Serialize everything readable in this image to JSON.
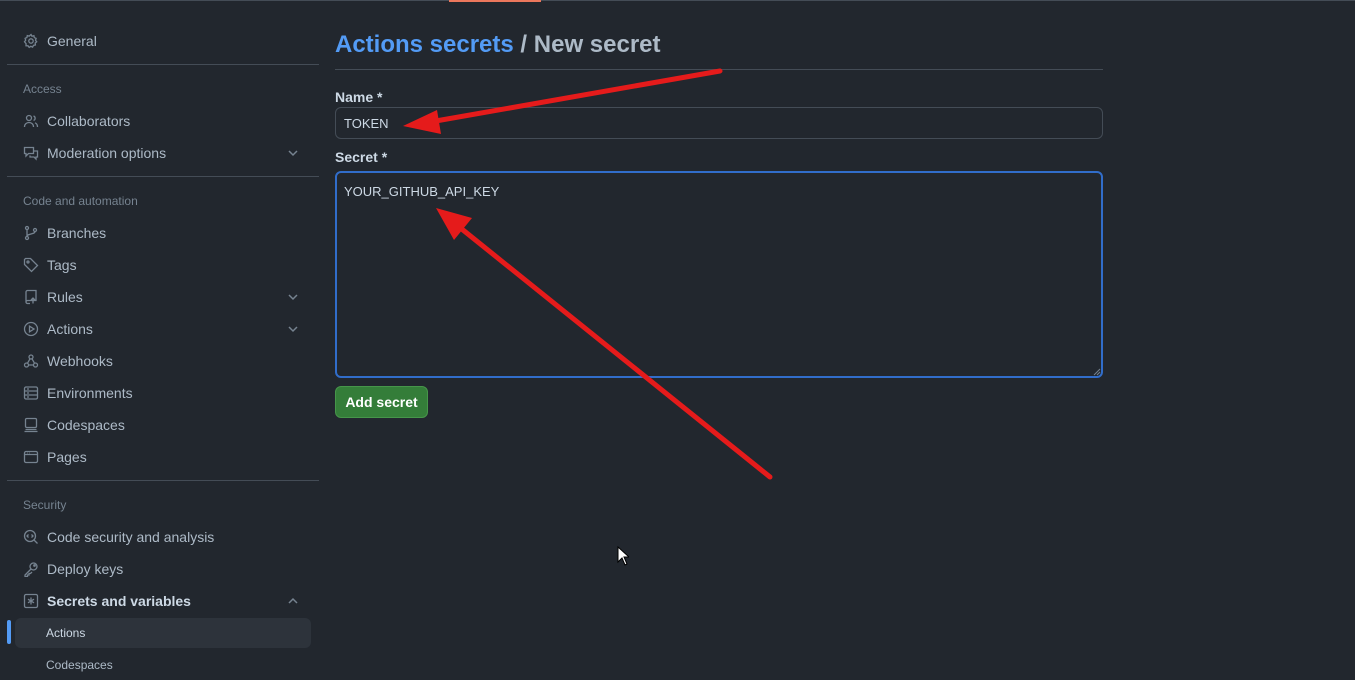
{
  "page": {
    "title_link": "Actions secrets",
    "title_separator": "/",
    "title_current": "New secret"
  },
  "sidebar": {
    "general": {
      "label": "General",
      "icon": "gear-icon"
    },
    "access": {
      "heading": "Access",
      "items": [
        {
          "label": "Collaborators",
          "icon": "people-icon"
        },
        {
          "label": "Moderation options",
          "icon": "comment-discussion-icon",
          "expandable": true
        }
      ]
    },
    "code_automation": {
      "heading": "Code and automation",
      "items": [
        {
          "label": "Branches",
          "icon": "git-branch-icon"
        },
        {
          "label": "Tags",
          "icon": "tag-icon"
        },
        {
          "label": "Rules",
          "icon": "repo-push-icon",
          "expandable": true
        },
        {
          "label": "Actions",
          "icon": "play-icon",
          "expandable": true
        },
        {
          "label": "Webhooks",
          "icon": "webhook-icon"
        },
        {
          "label": "Environments",
          "icon": "server-icon"
        },
        {
          "label": "Codespaces",
          "icon": "codespaces-icon"
        },
        {
          "label": "Pages",
          "icon": "browser-icon"
        }
      ]
    },
    "security": {
      "heading": "Security",
      "items": [
        {
          "label": "Code security and analysis",
          "icon": "codescan-icon"
        },
        {
          "label": "Deploy keys",
          "icon": "key-icon"
        },
        {
          "label": "Secrets and variables",
          "icon": "key-asterisk-icon",
          "expanded": true
        }
      ],
      "subitems": [
        {
          "label": "Actions",
          "selected": true
        },
        {
          "label": "Codespaces"
        }
      ]
    }
  },
  "form": {
    "name_label": "Name *",
    "name_value": "TOKEN",
    "secret_label": "Secret *",
    "secret_value": "YOUR_GITHUB_API_KEY",
    "submit_label": "Add secret"
  },
  "colors": {
    "background": "#22272e",
    "accent_link": "#539bf5",
    "primary_button": "#347d39",
    "annotation_arrow": "#e51b1b",
    "focus_border": "#316dca"
  }
}
